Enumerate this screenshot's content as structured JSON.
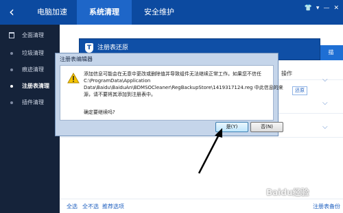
{
  "topbar": {
    "tabs": [
      {
        "label": "电脑加速"
      },
      {
        "label": "系统清理"
      },
      {
        "label": "安全维护"
      }
    ],
    "window_icons": [
      "skin-icon",
      "menu-icon",
      "minimize-icon",
      "close-icon"
    ],
    "window_glyphs": [
      "👕",
      "▾",
      "—",
      "✕"
    ]
  },
  "sidebar": {
    "items": [
      {
        "label": "全面清理"
      },
      {
        "label": "垃圾清理"
      },
      {
        "label": "痕迹清理"
      },
      {
        "label": "注册表清理"
      },
      {
        "label": "插件清理"
      }
    ],
    "active_index": 3
  },
  "main": {
    "title_partial": "...",
    "blue_button_partial": "描",
    "column_partial": "操作",
    "restore_button": "还原",
    "bottom_links": [
      "全选",
      "全不选",
      "推荐选项"
    ],
    "bottom_right_link": "注册表备份"
  },
  "outer_dialog": {
    "title": "注册表还原"
  },
  "dialog": {
    "title": "注册表编辑器",
    "message_lines": [
      "添加信息可能会在无意中更改或删除值并导致组件无法继续正常工作。如果您不信任",
      "C:\\ProgramData\\Application",
      "Data\\Baidu\\BaiduAn\\BDMSOCleaner\\RegBackupStore\\1419317124.reg 中此信息的来",
      "源，请不要将其添加到注册表中。"
    ],
    "question": "确定要继续吗?",
    "yes_button": "是(Y)",
    "no_button": "否(N)"
  },
  "watermark": "Baidu经验"
}
